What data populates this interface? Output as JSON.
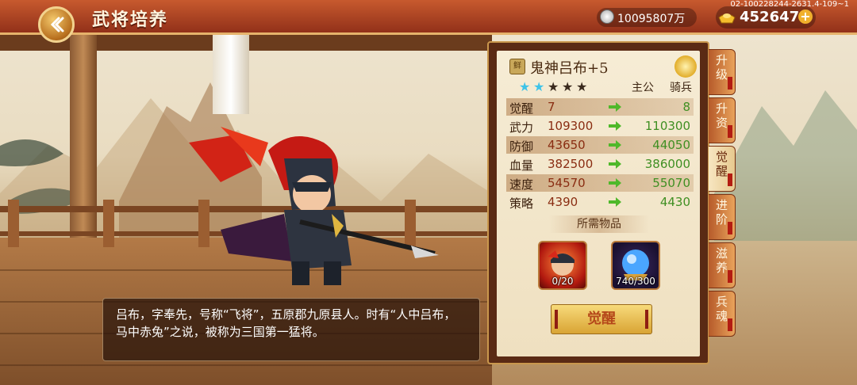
{
  "header": {
    "title": "武将培养",
    "silver_value": "10095807万",
    "gold_value": "452647",
    "add_label": "+",
    "server_info": "02-100228244-2631.4-109~1"
  },
  "hero": {
    "badge": "鲜",
    "name": "鬼神吕布+5",
    "stars_filled": 2,
    "stars_total": 5,
    "role": "主公",
    "type": "骑兵",
    "description": "吕布，字奉先，号称“飞将”，五原郡九原县人。时有“人中吕布，马中赤兔”之说，被称为三国第一猛将。"
  },
  "stats": [
    {
      "name": "觉醒",
      "current": "7",
      "next": "8"
    },
    {
      "name": "武力",
      "current": "109300",
      "next": "110300"
    },
    {
      "name": "防御",
      "current": "43650",
      "next": "44050"
    },
    {
      "name": "血量",
      "current": "382500",
      "next": "386000"
    },
    {
      "name": "速度",
      "current": "54570",
      "next": "55070"
    },
    {
      "name": "策略",
      "current": "4390",
      "next": "4430"
    }
  ],
  "required": {
    "header": "所需物品",
    "items": [
      {
        "name": "hero-fragment",
        "count": "0/20"
      },
      {
        "name": "awakening-orb",
        "count": "740/300"
      }
    ]
  },
  "actions": {
    "awaken_label": "觉醒"
  },
  "side_tabs": [
    {
      "label": "升级",
      "active": false
    },
    {
      "label": "升资",
      "active": false
    },
    {
      "label": "觉醒",
      "active": true
    },
    {
      "label": "进阶",
      "active": false
    },
    {
      "label": "滋养",
      "active": false
    },
    {
      "label": "兵魂",
      "active": false
    }
  ],
  "colors": {
    "current_value": "#8a2d12",
    "next_value": "#3f8f22",
    "star_filled": "#3ec3e8",
    "star_empty": "#3a2a1e"
  }
}
